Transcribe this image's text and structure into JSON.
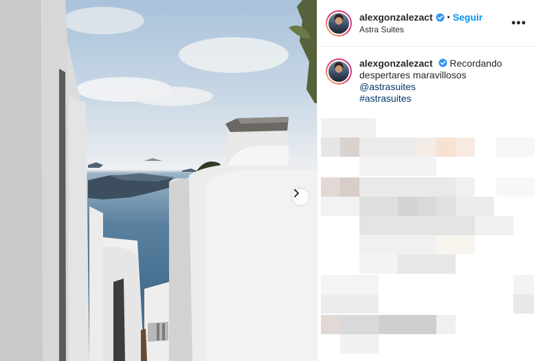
{
  "post": {
    "username": "alexgonzalezact",
    "follow_label": "Seguir",
    "separator": "•",
    "location": "Astra Suites",
    "more_label": "•••"
  },
  "caption": {
    "username": "alexgonzalezact",
    "text": "Recordando despertares maravillosos",
    "mention": "@astrasuites",
    "hashtag": "#astrasuites"
  },
  "icons": {
    "verified": "verified-badge-icon",
    "next": "chevron-right-icon",
    "more": "more-options-icon"
  },
  "colors": {
    "accent": "#0095f6",
    "link": "#00376b",
    "verified": "#3897f0"
  }
}
